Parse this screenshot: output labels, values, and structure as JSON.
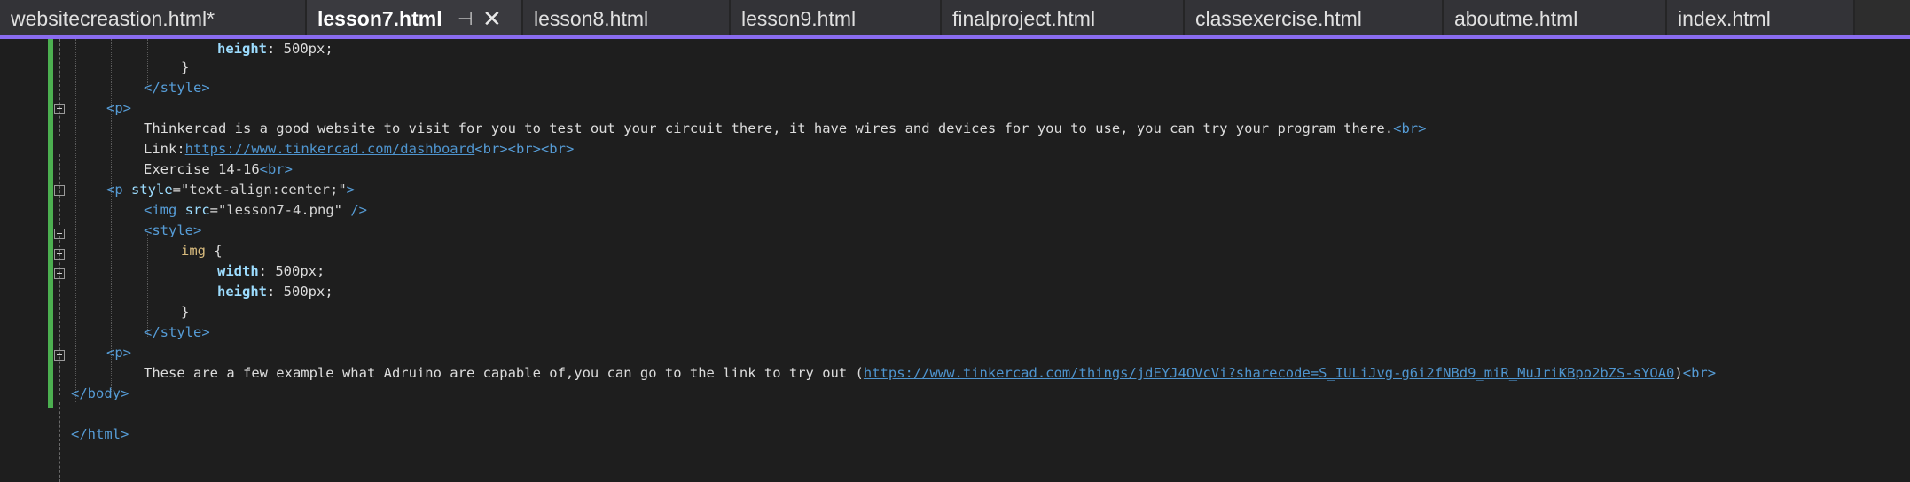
{
  "tabs": [
    {
      "label": "websitecreastion.html*",
      "active": false
    },
    {
      "label": "lesson7.html",
      "active": true
    },
    {
      "label": "lesson8.html",
      "active": false
    },
    {
      "label": "lesson9.html",
      "active": false
    },
    {
      "label": "finalproject.html",
      "active": false
    },
    {
      "label": "classexercise.html",
      "active": false
    },
    {
      "label": "aboutme.html",
      "active": false
    },
    {
      "label": "index.html",
      "active": false
    }
  ],
  "tab_icons": {
    "pin": "pin-icon",
    "close": "close-icon"
  },
  "colors": {
    "accent": "#8a6cf0",
    "change_bar": "#4caf50",
    "tag": "#569cd6",
    "attr": "#9cdcfe",
    "link": "#4e94ce"
  },
  "code": {
    "l1_prop": "height",
    "l1_rest": ": 500px;",
    "l2": "}",
    "l3": "</style>",
    "l4": "<p>",
    "l5_text": "Thinkercad is a good website to visit for you to test out your circuit there, it have wires and devices for you to use, you can try your program there.",
    "l5_tag": "<br>",
    "l6_text": "Link:",
    "l6_link": "https://www.tinkercad.com/dashboard",
    "l6_tags": "<br><br><br>",
    "l7_text": "Exercise 14-16",
    "l7_tag": "<br>",
    "l8_open": "<p",
    "l8_attr": " style",
    "l8_eq": "=",
    "l8_val": "\"text-align:center;\"",
    "l8_close": ">",
    "l9_open": "<img",
    "l9_attr": " src",
    "l9_eq": "=",
    "l9_val": "\"lesson7-4.png\"",
    "l9_close": " />",
    "l10": "<style>",
    "l11_sel": "img",
    "l11_brace": " {",
    "l12_prop": "width",
    "l12_rest": ": 500px;",
    "l13_prop": "height",
    "l13_rest": ": 500px;",
    "l14": "}",
    "l15": "</style>",
    "l16": "<p>",
    "l17_text": "These are a few example what Adruino are capable of,you can go to the link to try out (",
    "l17_link": "https://www.tinkercad.com/things/jdEYJ4OVcVi?sharecode=S_IULiJvg-g6i2fNBd9_miR_MuJriKBpo2bZS-sYOA0",
    "l17_paren": ")",
    "l17_tag": "<br>",
    "l18": "</body>",
    "l20": "</html>"
  }
}
